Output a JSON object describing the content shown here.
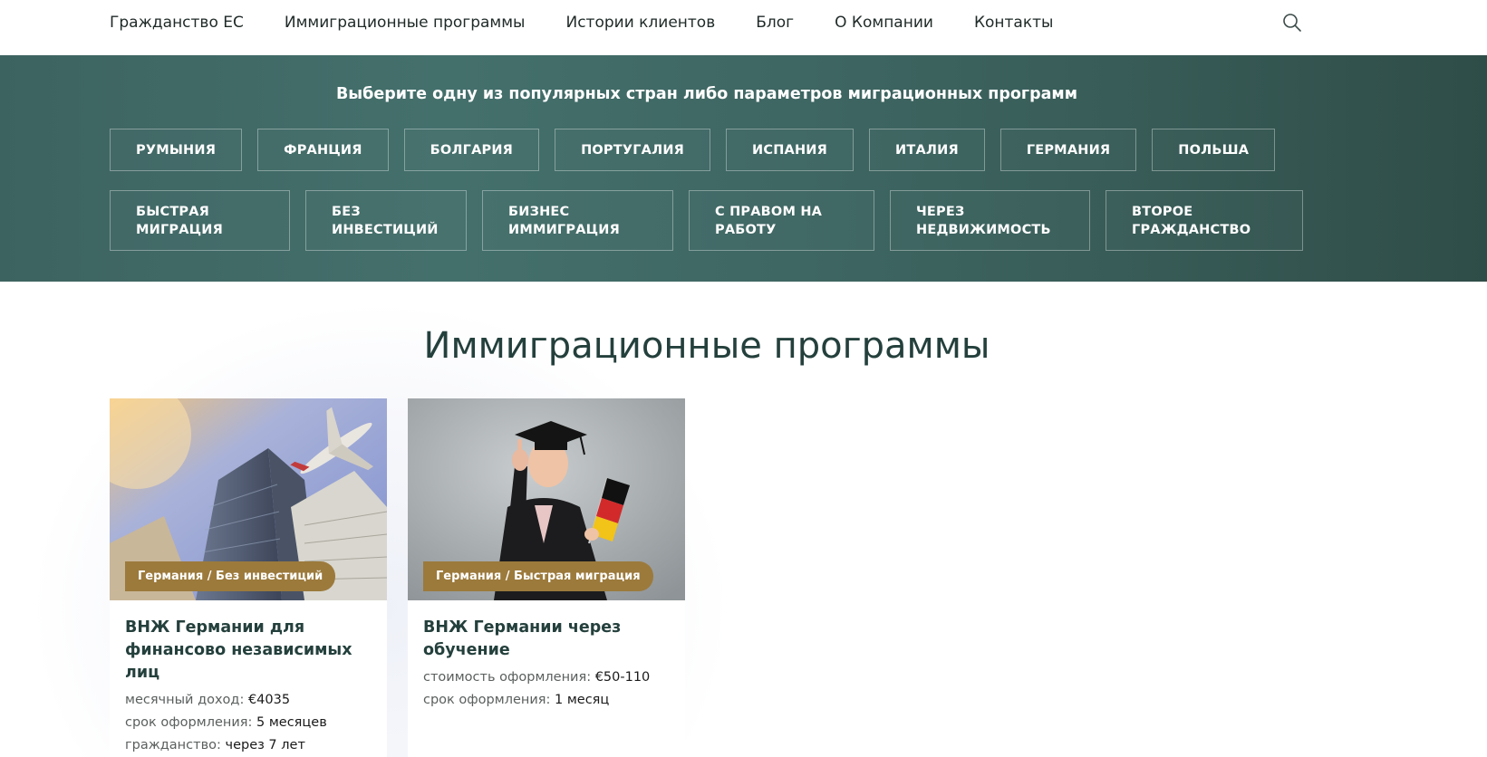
{
  "nav": {
    "items": [
      "Гражданство ЕС",
      "Иммиграционные программы",
      "Истории клиентов",
      "Блог",
      "О Компании",
      "Контакты"
    ],
    "search_icon": "search-icon"
  },
  "filters": {
    "heading": "Выберите одну из популярных стран либо параметров миграционных программ",
    "countries": [
      "РУМЫНИЯ",
      "ФРАНЦИЯ",
      "БОЛГАРИЯ",
      "ПОРТУГАЛИЯ",
      "ИСПАНИЯ",
      "ИТАЛИЯ",
      "ГЕРМАНИЯ",
      "ПОЛЬША"
    ],
    "params": [
      [
        "БЫСТРАЯ",
        "МИГРАЦИЯ"
      ],
      [
        "БЕЗ",
        "ИНВЕСТИЦИЙ"
      ],
      [
        "БИЗНЕС",
        "ИММИГРАЦИЯ"
      ],
      [
        "С ПРАВОМ НА",
        "РАБОТУ"
      ],
      [
        "ЧЕРЕЗ",
        "НЕДВИЖИМОСТЬ"
      ],
      [
        "ВТОРОЕ",
        "ГРАЖДАНСТВО"
      ]
    ]
  },
  "section": {
    "title": "Иммиграционные программы"
  },
  "cards": [
    {
      "tag": "Германия / Без инвестиций",
      "title": "ВНЖ Германии для финансово независимых лиц",
      "meta": [
        {
          "label": "месячный доход:",
          "value": "€4035"
        },
        {
          "label": "срок оформления:",
          "value": "5 месяцев"
        },
        {
          "label": "гражданство:",
          "value": "через 7 лет"
        }
      ]
    },
    {
      "tag": "Германия / Быстрая миграция",
      "title": "ВНЖ Германии через обучение",
      "meta": [
        {
          "label": "стоимость оформления:",
          "value": "€50-110"
        },
        {
          "label": "срок оформления:",
          "value": "1 месяц"
        }
      ]
    }
  ],
  "colors": {
    "band": "#3d6360",
    "tag": "#9c7a3c",
    "title": "#24403c"
  }
}
